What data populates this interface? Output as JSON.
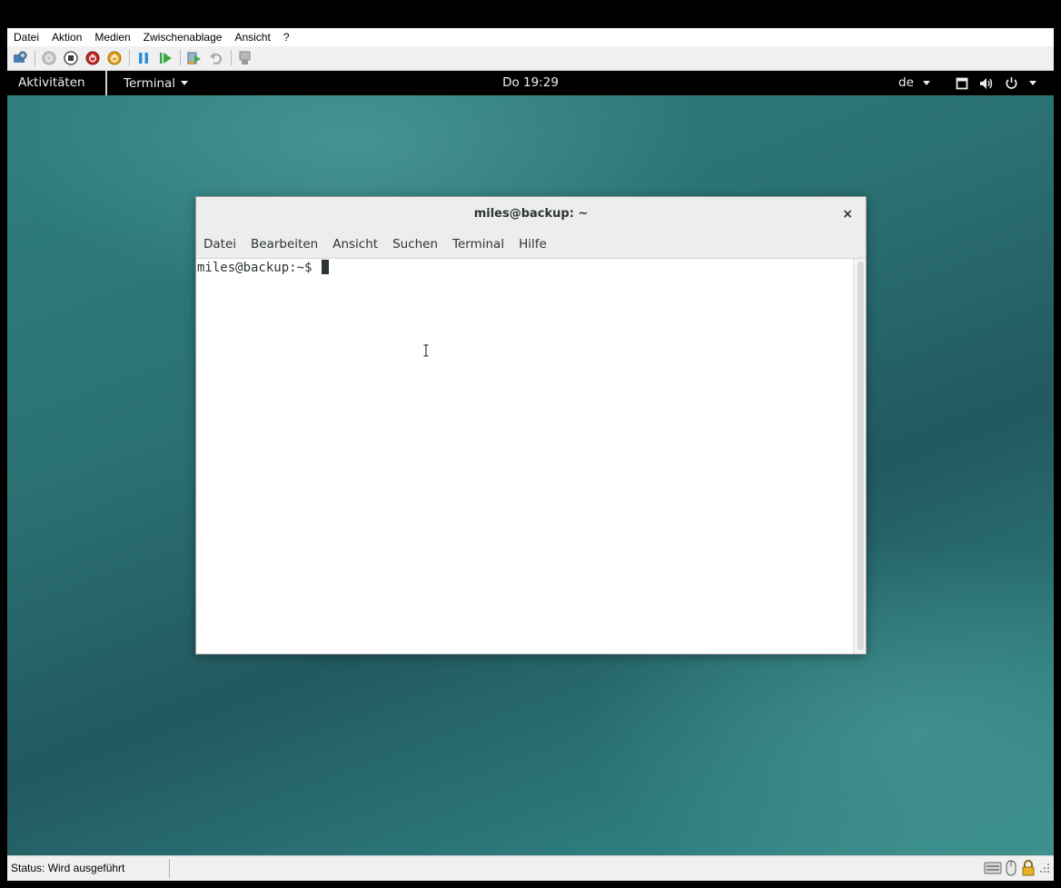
{
  "host": {
    "menu": [
      "Datei",
      "Aktion",
      "Medien",
      "Zwischenablage",
      "Ansicht",
      "?"
    ],
    "toolbar_icons": [
      "settings-icon",
      "start-icon",
      "stop-icon",
      "shutdown-icon",
      "power-icon",
      "pause-icon",
      "resume-icon",
      "checkpoint-icon",
      "revert-icon",
      "enhanced-session-icon"
    ],
    "status": "Status: Wird ausgeführt",
    "status_icons": [
      "keyboard-icon",
      "mouse-icon",
      "lock-icon"
    ]
  },
  "guest": {
    "topbar": {
      "activities": "Aktivitäten",
      "app_name": "Terminal",
      "clock": "Do 19:29",
      "language": "de"
    },
    "terminal": {
      "title": "miles@backup: ~",
      "close": "×",
      "menu": [
        "Datei",
        "Bearbeiten",
        "Ansicht",
        "Suchen",
        "Terminal",
        "Hilfe"
      ],
      "prompt": "miles@backup:~$ "
    }
  },
  "colors": {
    "desktop_teal": "#2b7172",
    "topbar_bg": "#000000",
    "terminal_text": "#2e3436"
  }
}
